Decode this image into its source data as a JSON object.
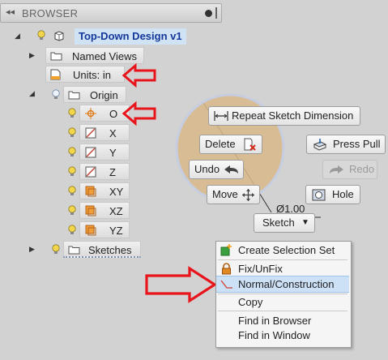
{
  "browser": {
    "title": "BROWSER",
    "root": "Top-Down Design v1",
    "named_views": "Named Views",
    "units": "Units: in",
    "origin": "Origin",
    "origin_items": [
      "O",
      "X",
      "Y",
      "Z",
      "XY",
      "XZ",
      "YZ"
    ],
    "sketches": "Sketches"
  },
  "marking_menu": {
    "repeat": "Repeat Sketch Dimension",
    "delete": "Delete",
    "undo": "Undo",
    "move": "Move",
    "press_pull": "Press Pull",
    "redo": "Redo",
    "hole": "Hole",
    "sketch": "Sketch",
    "dimension_text": "Ø1.00"
  },
  "context_menu": {
    "create_selection_set": "Create Selection Set",
    "fix_unfix": "Fix/UnFix",
    "normal_construction": "Normal/Construction",
    "copy": "Copy",
    "find_in_browser": "Find in Browser",
    "find_in_window": "Find in Window"
  },
  "colors": {
    "annotation_arrow": "#e8141b",
    "highlight": "#cce0f6",
    "marking_disc": "#d9b98a"
  }
}
